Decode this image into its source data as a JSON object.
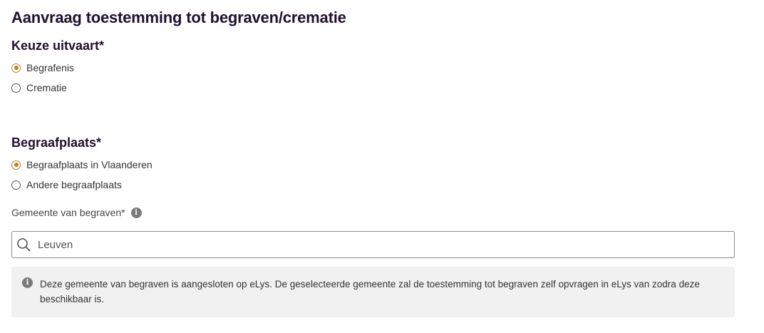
{
  "page": {
    "title": "Aanvraag toestemming tot begraven/crematie"
  },
  "keuze_uitvaart": {
    "title": "Keuze uitvaart*",
    "options": [
      {
        "label": "Begrafenis",
        "checked": true
      },
      {
        "label": "Crematie",
        "checked": false
      }
    ]
  },
  "begraafplaats": {
    "title": "Begraafplaats*",
    "options": [
      {
        "label": "Begraafplaats in Vlaanderen",
        "checked": true
      },
      {
        "label": "Andere begraafplaats",
        "checked": false
      }
    ]
  },
  "gemeente": {
    "label": "Gemeente van begraven*",
    "value": "Leuven",
    "info_icon": "info-icon",
    "search_icon": "search-icon"
  },
  "notice": {
    "text": "Deze gemeente van begraven is aangesloten op eLys. De geselecteerde gemeente zal de toestemming tot begraven zelf opvragen in eLys van zodra deze beschikbaar is."
  },
  "colors": {
    "heading": "#21102f",
    "radio_accent": "#c47f1c",
    "notice_bg": "#f1f1f1"
  }
}
